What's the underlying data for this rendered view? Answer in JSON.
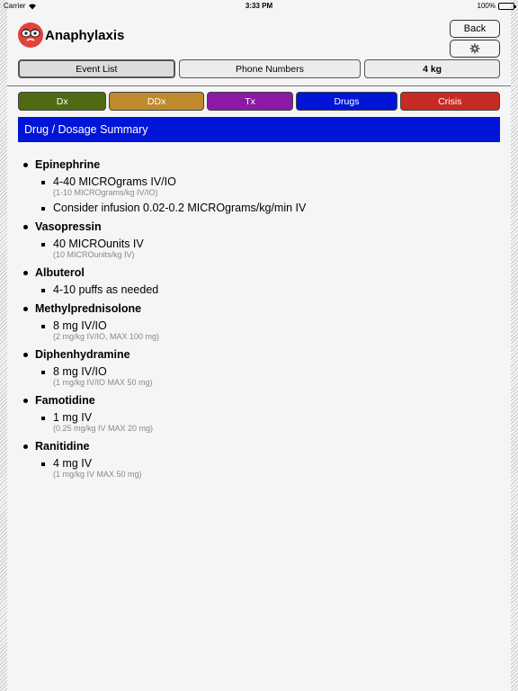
{
  "status_bar": {
    "carrier": "Carrier",
    "time": "3:33 PM",
    "battery": "100%"
  },
  "header": {
    "title": "Anaphylaxis",
    "back_label": "Back",
    "settings_icon": "gear-icon"
  },
  "nav": {
    "event_list": "Event List",
    "phone_numbers": "Phone Numbers",
    "weight": "4 kg"
  },
  "tabs": [
    {
      "label": "Dx",
      "color": "#4e6b14"
    },
    {
      "label": "DDx",
      "color": "#c08a2c"
    },
    {
      "label": "Tx",
      "color": "#8c1aa5"
    },
    {
      "label": "Drugs",
      "color": "#0015d8"
    },
    {
      "label": "Crisis",
      "color": "#c82b24"
    }
  ],
  "section": {
    "title": "Drug / Dosage Summary",
    "color": "#0015d8"
  },
  "drugs": [
    {
      "name": "Epinephrine",
      "doses": [
        {
          "main": "4-40 MICROgrams IV/IO",
          "sub": "(1-10 MICROgrams/kg IV/IO)"
        },
        {
          "main": "Consider infusion 0.02-0.2 MICROgrams/kg/min IV",
          "sub": ""
        }
      ]
    },
    {
      "name": "Vasopressin",
      "doses": [
        {
          "main": "40 MICROunits IV",
          "sub": "(10 MICROunits/kg IV)"
        }
      ]
    },
    {
      "name": "Albuterol",
      "doses": [
        {
          "main": "4-10 puffs as needed",
          "sub": ""
        }
      ]
    },
    {
      "name": "Methylprednisolone",
      "doses": [
        {
          "main": "8 mg IV/IO",
          "sub": "(2 mg/kg IV/IO, MAX 100 mg)"
        }
      ]
    },
    {
      "name": "Diphenhydramine",
      "doses": [
        {
          "main": "8 mg IV/IO",
          "sub": "(1 mg/kg IV/IO MAX 50 mg)"
        }
      ]
    },
    {
      "name": "Famotidine",
      "doses": [
        {
          "main": "1 mg IV",
          "sub": "(0.25 mg/kg IV MAX 20 mg)"
        }
      ]
    },
    {
      "name": "Ranitidine",
      "doses": [
        {
          "main": "4 mg IV",
          "sub": "(1 mg/kg IV MAX 50 mg)"
        }
      ]
    }
  ]
}
